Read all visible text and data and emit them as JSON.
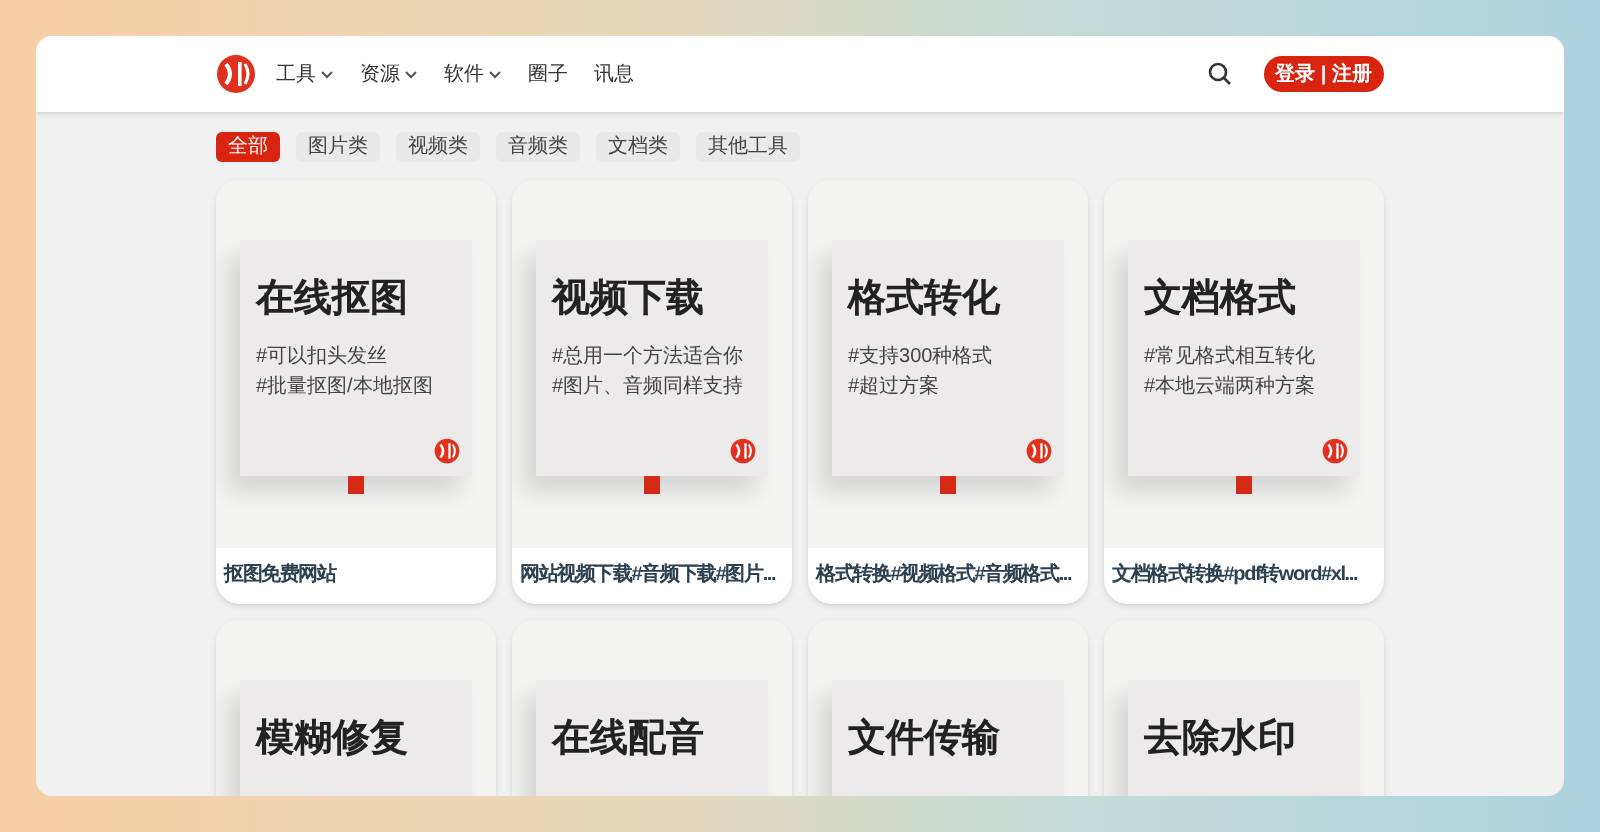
{
  "nav": {
    "items": [
      {
        "label": "工具",
        "dropdown": true
      },
      {
        "label": "资源",
        "dropdown": true
      },
      {
        "label": "软件",
        "dropdown": true
      },
      {
        "label": "圈子",
        "dropdown": false
      },
      {
        "label": "讯息",
        "dropdown": false
      }
    ],
    "login": "登录 | 注册"
  },
  "filters": [
    {
      "label": "全部",
      "selected": true
    },
    {
      "label": "图片类",
      "selected": false
    },
    {
      "label": "视频类",
      "selected": false
    },
    {
      "label": "音频类",
      "selected": false
    },
    {
      "label": "文档类",
      "selected": false
    },
    {
      "label": "其他工具",
      "selected": false
    }
  ],
  "cards": [
    {
      "title": "在线抠图",
      "tags": [
        "#可以扣头发丝",
        "#批量抠图/本地抠图"
      ],
      "caption": "抠图免费网站"
    },
    {
      "title": "视频下载",
      "tags": [
        "#总用一个方法适合你",
        "#图片、音频同样支持"
      ],
      "caption": "网站视频下载#音频下载#图片..."
    },
    {
      "title": "格式转化",
      "tags": [
        "#支持300种格式",
        "#超过方案"
      ],
      "caption": "格式转换#视频格式#音频格式..."
    },
    {
      "title": "文档格式",
      "tags": [
        "#常见格式相互转化",
        "#本地云端两种方案"
      ],
      "caption": "文档格式转换#pdf转word#xl..."
    },
    {
      "title": "模糊修复"
    },
    {
      "title": "在线配音"
    },
    {
      "title": "文件传输"
    },
    {
      "title": "去除水印"
    }
  ]
}
